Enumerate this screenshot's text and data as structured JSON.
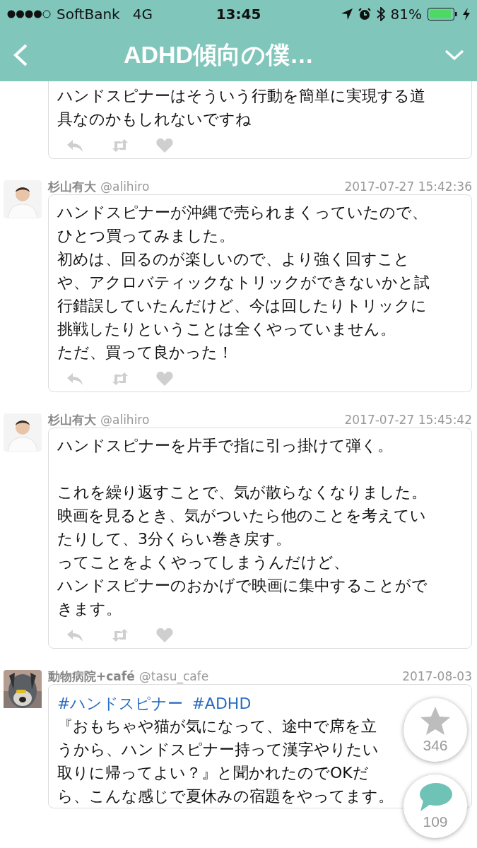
{
  "status_bar": {
    "carrier": "SoftBank",
    "network": "4G",
    "time": "13:45",
    "battery": "81%"
  },
  "header": {
    "title": "ADHD傾向の僕…"
  },
  "top_tweet": {
    "paragraphs": [
      [
        "ハンドスピナーはそういう行動を簡単に実現する道",
        "具なのかもしれないですね"
      ]
    ]
  },
  "tweets": [
    {
      "name": "杉山有大",
      "handle": "@alihiro",
      "time": "2017-07-27 15:42:36",
      "avatar": {
        "kind": "picture"
      },
      "paragraphs": [
        [
          "ハンドスピナーが沖縄で売られまくっていたので、",
          "ひとつ買ってみました。",
          "初めは、回るのが楽しいので、より強く回すこと",
          "や、アクロバティックなトリックができないかと試",
          "行錯誤していたんだけど、今は回したりトリックに",
          "挑戦したりということは全くやっていません。",
          "ただ、買って良かった！"
        ]
      ]
    },
    {
      "name": "杉山有大",
      "handle": "@alihiro",
      "time": "2017-07-27 15:45:42",
      "avatar": {
        "kind": "picture"
      },
      "paragraphs": [
        [
          "ハンドスピナーを片手で指に引っ掛けて弾く。"
        ],
        [
          "これを繰り返すことで、気が散らなくなりました。",
          "映画を見るとき、気がついたら他のことを考えてい",
          "たりして、3分くらい巻き戻す。",
          "ってことをよくやってしまうんだけど、",
          "ハンドスピナーのおかげで映画に集中することがで",
          "きます。"
        ]
      ]
    },
    {
      "name": "動物病院+café",
      "handle": "@tasu_cafe",
      "time": "2017-08-03",
      "avatar": {
        "kind": "picture"
      },
      "hashtags": [
        "#ハンドスピナー",
        "#ADHD"
      ],
      "paragraphs": [
        [
          "『おもちゃや猫が気になって、途中で席を立",
          "うから、ハンドスピナー持って漢字やりたい",
          "取りに帰ってよい？』と聞かれたのでOKだ",
          "ら、こんな感じで夏休みの宿題をやってます。"
        ]
      ]
    }
  ],
  "fabs": [
    {
      "kind": "favorite",
      "count": "346"
    },
    {
      "kind": "comment",
      "count": "109"
    }
  ]
}
